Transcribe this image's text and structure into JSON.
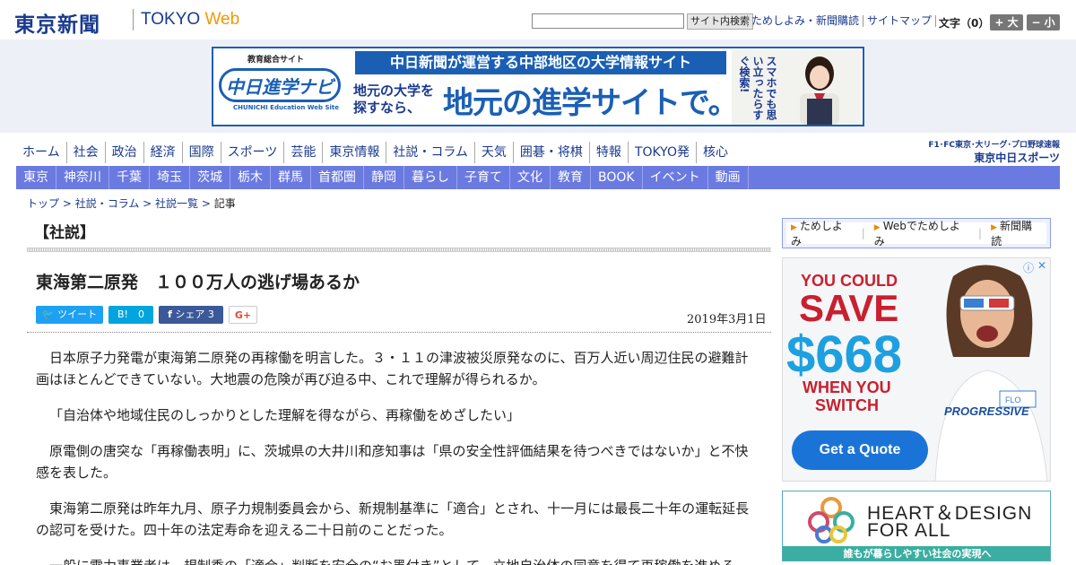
{
  "header": {
    "logo_jp": "東京新聞",
    "logo_en_a": "TOKYO ",
    "logo_en_b": "Web",
    "search_button": "サイト内検索",
    "links": [
      "ためしよみ・新聞購読",
      "サイトマップ"
    ],
    "font_size_label": "文字（0）",
    "font_plus": "+ 大",
    "font_minus": "− 小"
  },
  "banner": {
    "small_label": "教育総合サイト",
    "logo_text": "中日進学ナビ",
    "logo_sub": "CHUNICHI Education Web Site",
    "top_text": "中日新聞が運営する中部地区の大学情報サイト",
    "left_text": "地元の大学を探すなら、",
    "main_text": "地元の進学サイトで。",
    "side_text": "スマホでも思い立ったらすぐ検索!"
  },
  "mainnav": [
    "ホーム",
    "社会",
    "政治",
    "経済",
    "国際",
    "スポーツ",
    "芸能",
    "東京情報",
    "社説・コラム",
    "天気",
    "囲碁・将棋",
    "特報",
    "TOKYO発",
    "核心"
  ],
  "chunichi": {
    "line1": "F1･FC東京･大リーグ･プロ野球速報",
    "line2": "東京中日スポーツ"
  },
  "subnav": [
    "東京",
    "神奈川",
    "千葉",
    "埼玉",
    "茨城",
    "栃木",
    "群馬",
    "首都圏",
    "静岡",
    "暮らし",
    "子育て",
    "文化",
    "教育",
    "BOOK",
    "イベント",
    "動画"
  ],
  "breadcrumb": {
    "items": [
      "トップ",
      "社説・コラム",
      "社説一覧"
    ],
    "current": "記事"
  },
  "article": {
    "section": "【社説】",
    "headline": "東海第二原発　１００万人の逃げ場あるか",
    "share": {
      "tweet": "ツイート",
      "hatena": "B!　0",
      "facebook": "シェア 3",
      "gplus": "G+"
    },
    "date": "2019年3月1日",
    "paragraphs": [
      "日本原子力発電が東海第二原発の再稼働を明言した。３・１１の津波被災原発なのに、百万人近い周辺住民の避難計画はほとんどできていない。大地震の危険が再び迫る中、これで理解が得られるか。",
      "「自治体や地域住民のしっかりとした理解を得ながら、再稼働をめざしたい」",
      "原電側の唐突な「再稼働表明」に、茨城県の大井川和彦知事は「県の安全性評価結果を待つべきではないか」と不快感を表した。",
      "東海第二原発は昨年九月、原子力規制委員会から、新規制基準に「適合」とされ、十一月には最長二十年の運転延長の認可を受けた。四十年の法定寿命を迎える二十日前のことだった。",
      "一般に電力事業者は、規制委の「適合」判断を安全の“お墨付き”として、立地自治体の同意を得て再稼働を進める。"
    ]
  },
  "sidebar": {
    "links": [
      "ためしよみ",
      "Webでためしよみ",
      "新聞購読"
    ],
    "ad1": {
      "line1": "YOU COULD",
      "line2": "SAVE",
      "line3": "$668",
      "line4a": "WHEN YOU",
      "line4b": "SWITCH",
      "button": "Get a Quote",
      "brand": "PROGRESSIVE",
      "badge": "FLO"
    },
    "ad2": {
      "line1": "HEART＆DESIGN",
      "line2": "FOR ALL",
      "bar": "誰もが暮らしやすい社会の実現へ"
    }
  },
  "colors": {
    "brand": "#1a3a8f",
    "accent": "#f39800",
    "subnav": "#6a7ae0",
    "banner_blue": "#1a5fb4"
  }
}
